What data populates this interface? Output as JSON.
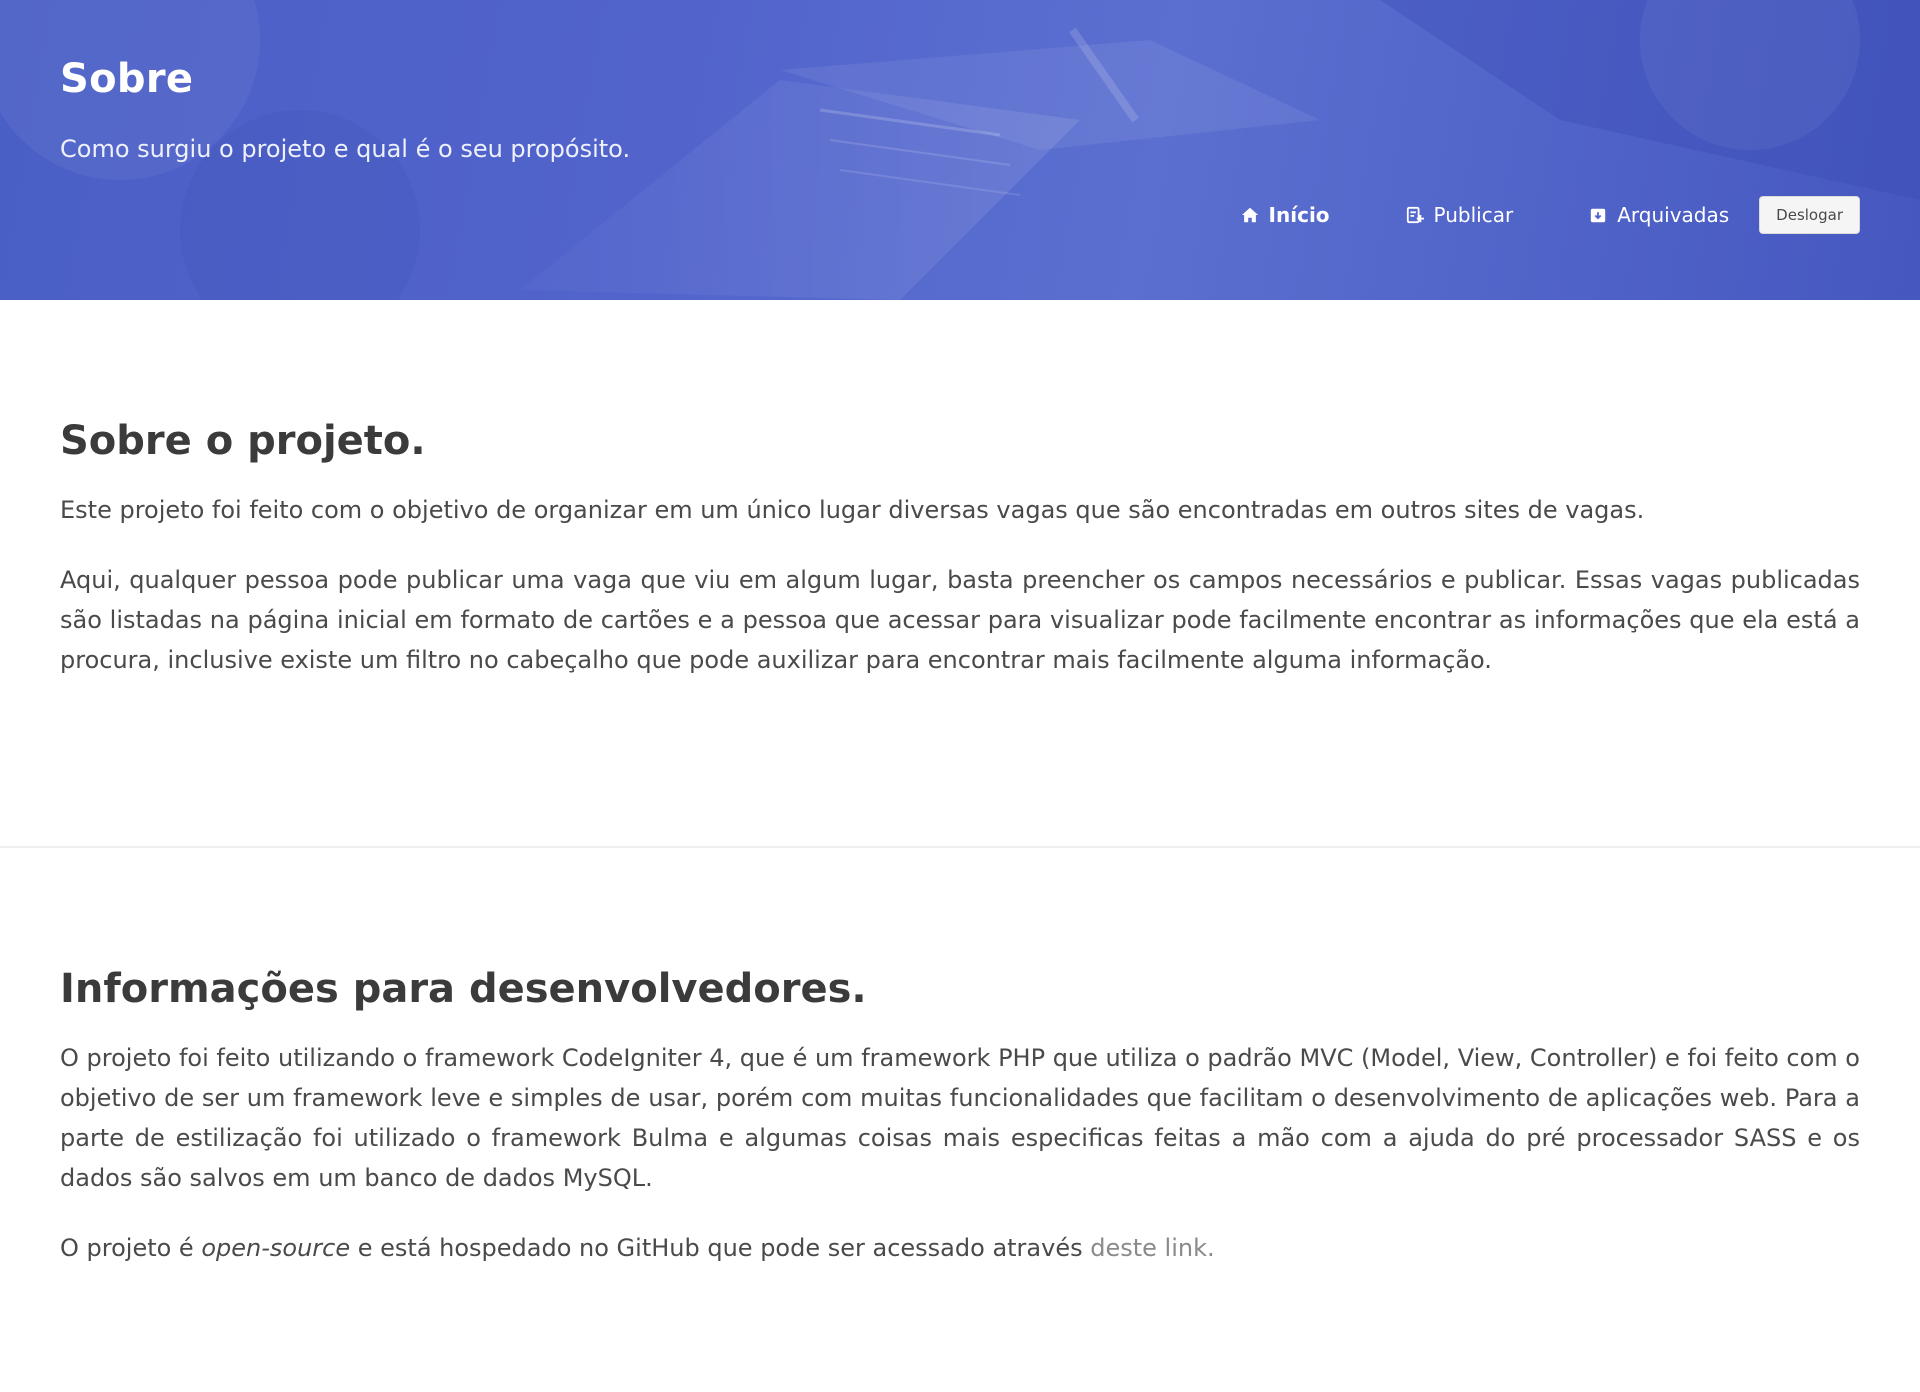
{
  "header": {
    "title": "Sobre",
    "subtitle": "Como surgiu o projeto e qual é o seu propósito."
  },
  "nav": {
    "items": [
      {
        "label": "Início",
        "icon": "home-icon",
        "active": true
      },
      {
        "label": "Publicar",
        "icon": "publish-icon",
        "active": false
      },
      {
        "label": "Arquivadas",
        "icon": "archive-icon",
        "active": false
      }
    ],
    "logout_label": "Deslogar"
  },
  "about": {
    "title": "Sobre o projeto.",
    "paragraph1": "Este projeto foi feito com o objetivo de organizar em um único lugar diversas vagas que são encontradas em outros sites de vagas.",
    "paragraph2": "Aqui, qualquer pessoa pode publicar uma vaga que viu em algum lugar, basta preencher os campos necessários e publicar. Essas vagas publicadas são listadas na página inicial em formato de cartões e a pessoa que acessar para visualizar pode facilmente encontrar as informações que ela está a procura, inclusive existe um filtro no cabeçalho que pode auxilizar para encontrar mais facilmente alguma informação."
  },
  "dev": {
    "title": "Informações para desenvolvedores.",
    "paragraph1": "O projeto foi feito utilizando o framework CodeIgniter 4, que é um framework PHP que utiliza o padrão MVC (Model, View, Controller) e foi feito com o objetivo de ser um framework leve e simples de usar, porém com muitas funcionalidades que facilitam o desenvolvimento de aplicações web. Para a parte de estilização foi utilizado o framework Bulma e algumas coisas mais especificas feitas a mão com a ajuda do pré processador SASS e os dados são salvos em um banco de dados MySQL.",
    "paragraph2_prefix": "O projeto é ",
    "paragraph2_emphasis": "open-source",
    "paragraph2_middle": " e está hospedado no GitHub que pode ser acessado através ",
    "paragraph2_link": "deste link."
  },
  "colors": {
    "hero_background": "#4f63c9",
    "link": "#8a8a8a",
    "text": "#4a4a4a",
    "heading": "#3b3b3b"
  }
}
